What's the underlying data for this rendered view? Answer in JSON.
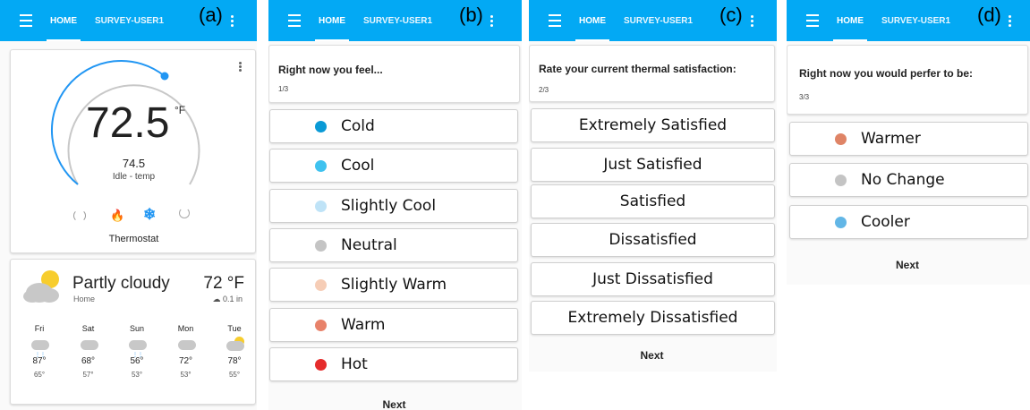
{
  "tabs": {
    "home": "HOME",
    "survey": "SURVEY-USER1"
  },
  "colors": {
    "appbar": "#03a9f4",
    "accent": "#2196f3"
  },
  "panel_labels": {
    "a": "(a)",
    "b": "(b)",
    "c": "(c)",
    "d": "(d)"
  },
  "thermostat": {
    "temperature": "72.5",
    "unit": "°F",
    "target": "74.5",
    "status": "Idle - temp",
    "name": "Thermostat",
    "modes": [
      "cycle-icon",
      "flame-icon",
      "snowflake-icon",
      "power-icon"
    ],
    "active_mode": "snowflake-icon"
  },
  "weather": {
    "condition": "Partly cloudy",
    "location": "Home",
    "temperature": "72 °F",
    "precipitation": "0.1 in",
    "forecast": [
      {
        "day": "Fri",
        "icon": "cloud-rain-icon",
        "high": "87°",
        "low": "65°"
      },
      {
        "day": "Sat",
        "icon": "cloud-icon",
        "high": "68°",
        "low": "57°"
      },
      {
        "day": "Sun",
        "icon": "cloud-rain-icon",
        "high": "56°",
        "low": "53°"
      },
      {
        "day": "Mon",
        "icon": "cloud-icon",
        "high": "72°",
        "low": "53°"
      },
      {
        "day": "Tue",
        "icon": "partly-cloudy-icon",
        "high": "78°",
        "low": "55°"
      }
    ]
  },
  "survey1": {
    "question": "Right now you feel...",
    "progress": "1/3",
    "options": [
      {
        "label": "Cold",
        "color": "#0a9ad6"
      },
      {
        "label": "Cool",
        "color": "#3fc2ef"
      },
      {
        "label": "Slightly Cool",
        "color": "#bfe3f7"
      },
      {
        "label": "Neutral",
        "color": "#c4c4c4"
      },
      {
        "label": "Slightly Warm",
        "color": "#f6cdb6"
      },
      {
        "label": "Warm",
        "color": "#e8826a"
      },
      {
        "label": "Hot",
        "color": "#e52c2c"
      }
    ],
    "next": "Next"
  },
  "survey2": {
    "question": "Rate your current thermal satisfaction:",
    "progress": "2/3",
    "options": [
      "Extremely Satisfied",
      "Just Satisfied",
      "Satisfied",
      "Dissatisfied",
      "Just Dissatisfied",
      "Extremely Dissatisfied"
    ],
    "next": "Next"
  },
  "survey3": {
    "question": "Right now you would perfer to be:",
    "progress": "3/3",
    "options": [
      {
        "label": "Warmer",
        "color": "#df8466"
      },
      {
        "label": "No Change",
        "color": "#c4c4c4"
      },
      {
        "label": "Cooler",
        "color": "#62b6e6"
      }
    ],
    "next": "Next"
  }
}
